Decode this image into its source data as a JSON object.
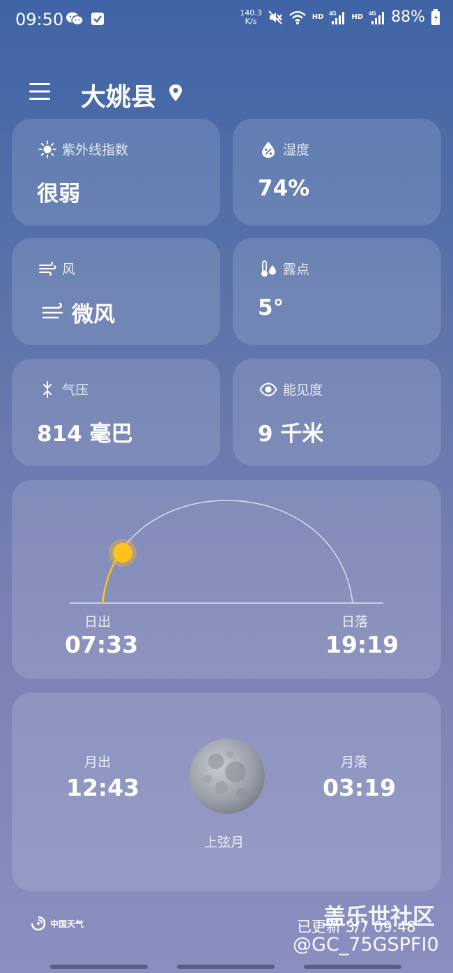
{
  "status_bar": {
    "time": "09:50",
    "net_speed_value": "140.3",
    "net_speed_unit": "K/s",
    "hd1": "HD",
    "sig1": "4G",
    "hd2": "HD",
    "sig2": "4G",
    "battery": "88%",
    "icons": [
      "wechat-icon",
      "checkbox-icon",
      "mute-icon",
      "wifi-icon",
      "signal-icon",
      "battery-icon"
    ]
  },
  "header": {
    "city": "大姚县",
    "menu_icon": "menu-icon",
    "location_icon": "pin-icon"
  },
  "details": [
    {
      "label": "紫外线指数",
      "value": "很弱",
      "icon": "sun-icon"
    },
    {
      "label": "湿度",
      "value": "74%",
      "icon": "humidity-icon"
    },
    {
      "label": "风",
      "value": "微风",
      "icon": "wind-icon"
    },
    {
      "label": "露点",
      "value": "5°",
      "icon": "dewpoint-icon"
    },
    {
      "label": "气压",
      "value": "814 毫巴",
      "icon": "pressure-icon"
    },
    {
      "label": "能见度",
      "value": "9 千米",
      "icon": "eye-icon"
    }
  ],
  "sun": {
    "sunrise_label": "日出",
    "sunrise_time": "07:33",
    "sunset_label": "日落",
    "sunset_time": "19:19"
  },
  "moon": {
    "moonrise_label": "月出",
    "moonrise_time": "12:43",
    "moonset_label": "月落",
    "moonset_time": "03:19",
    "phase": "上弦月"
  },
  "footer": {
    "brand": "中国天气",
    "updated": "已更新 3/7 09:48",
    "watermark_title": "盖乐世社区",
    "watermark_user": "@GC_75GSPFI0"
  },
  "colors": {
    "sun": "#ffc21a",
    "arc_lit": "#ffc21a",
    "arc": "#d9dcec"
  }
}
